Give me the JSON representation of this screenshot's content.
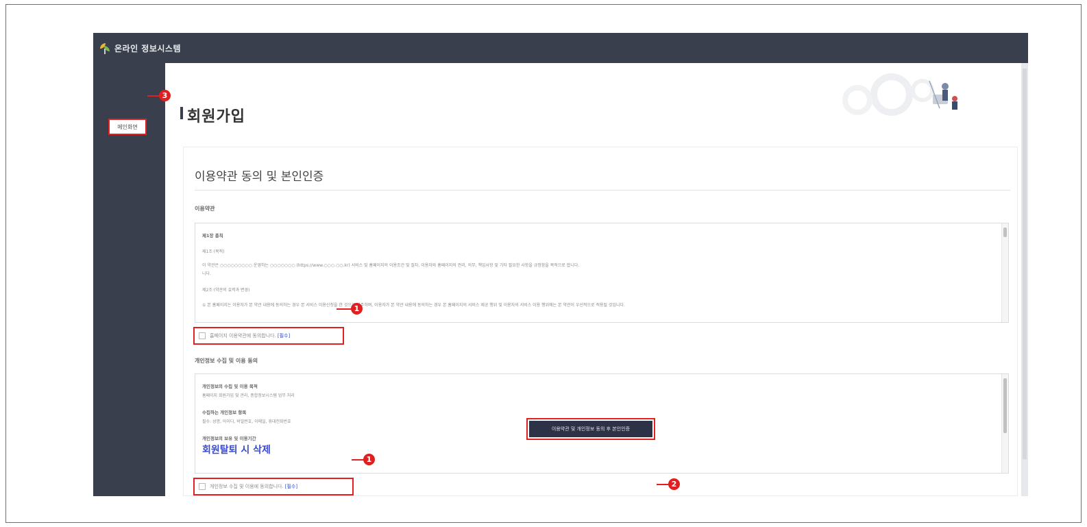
{
  "header": {
    "app_title": "온라인 정보시스템"
  },
  "sidebar": {
    "home_label": "메인화면"
  },
  "page": {
    "title": "회원가입"
  },
  "card": {
    "title": "이용약관 동의 및 본인인증"
  },
  "terms": {
    "section_label": "이용약관",
    "lines": [
      "제1장 총칙",
      "제1조 (목적)",
      "이 약관은 ○○○○○○○○○ 운영하는 ○○○○○○○ (https://www.○○○.○○.kr) 서비스 및 홈페이지의 이용조건 및 절차, 이용자와 홈페이지의 권리, 의무, 책임사항 및 기타 필요한 사항을 규정함을 목적으로 합니다.",
      "니다.",
      "제2조 (약관의 효력과 변경)",
      "① 본 홈페이지는 이용자가 본 약관 내용에 동의하는 경우 본 서비스 이용신청을 한 것으로 간주하며, 이용자가 본 약관 내용에 동의하는 경우 본 홈페이지의 서비스 제공 행위 및 이용자의 서비스 이용 행위에는 본 약관이 우선적으로 적용될 것입니다."
    ],
    "agree_label": "홈페이지 이용약관에 동의합니다.",
    "required_label": "[필수]"
  },
  "privacy": {
    "section_label": "개인정보 수집 및 이용 동의",
    "lines": [
      "개인정보의 수집 및 이용 목적",
      "홈페이지 회원가입 및 관리, 종합정보시스템 업무 처리",
      "수집하는 개인정보 항목",
      "필수: 성명, 아이디, 비밀번호, 이메일, 휴대전화번호",
      "개인정보의 보유 및 이용기간"
    ],
    "highlight": "회원탈퇴 시 삭제",
    "agree_label": "개인정보 수집 및 이용에 동의합니다.",
    "required_label": "[필수]"
  },
  "submit": {
    "label": "이용약관 및 개인정보 동의 후 본인인증"
  },
  "callouts": {
    "one": "1",
    "two": "2",
    "three": "3"
  }
}
